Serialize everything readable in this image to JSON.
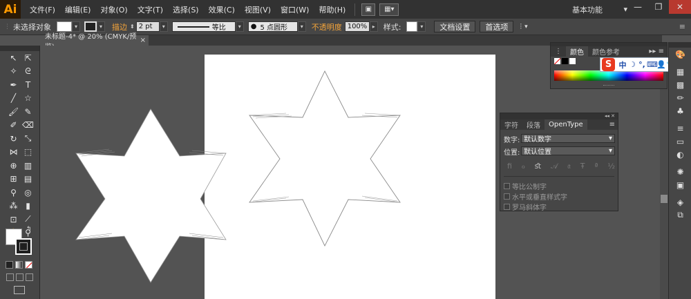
{
  "app": {
    "logo": "Ai",
    "workspace": "基本功能"
  },
  "menu": [
    "文件(F)",
    "编辑(E)",
    "对象(O)",
    "文字(T)",
    "选择(S)",
    "效果(C)",
    "视图(V)",
    "窗口(W)",
    "帮助(H)"
  ],
  "control": {
    "selection_status": "未选择对象",
    "stroke_label": "描边",
    "stroke_weight": "2 pt",
    "stroke_profile": "等比",
    "brush": "5 点圆形",
    "opacity_label": "不透明度",
    "opacity_value": "100%",
    "style_label": "样式:",
    "doc_setup": "文档设置",
    "preferences": "首选项"
  },
  "document": {
    "tab_title": "未标题-4* @ 20% (CMYK/预览)"
  },
  "color_panel": {
    "tabs": [
      "颜色",
      "颜色参考"
    ]
  },
  "ime": {
    "logo": "S",
    "mode": "中"
  },
  "opentype_panel": {
    "tabs": [
      "字符",
      "段落",
      "OpenType"
    ],
    "figure_label": "数字:",
    "figure_value": "默认数字",
    "position_label": "位置:",
    "position_value": "默认位置",
    "checkboxes": [
      "等比公制字",
      "水平或垂直样式字",
      "罗马斜体字"
    ]
  },
  "colors": {
    "accent": "#f2a33a",
    "menubar": "#323232",
    "panel": "#464646",
    "canvas": "#535353"
  }
}
